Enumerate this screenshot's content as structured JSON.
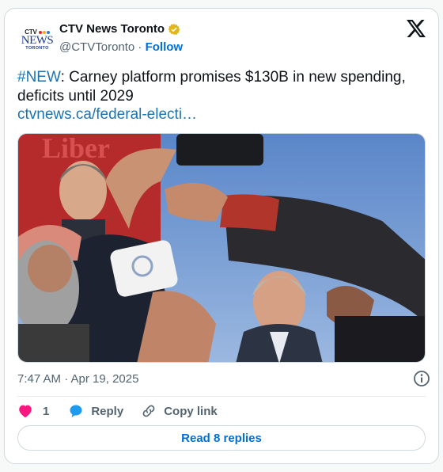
{
  "account": {
    "display_name": "CTV News Toronto",
    "handle": "@CTVToronto",
    "separator": " · ",
    "follow_label": "Follow",
    "logo_brand": "CTV",
    "logo_text": "NEWS",
    "logo_sub": "TORONTO",
    "verified_badge_color": "#e2b719"
  },
  "tweet": {
    "hashtag": "#NEW",
    "text": ": Carney platform promises $130B in new spending, deficits until 2029",
    "link": "ctvnews.ca/federal-electi…",
    "media_sign_text": "Liber"
  },
  "meta": {
    "timestamp": "7:47 AM · Apr 19, 2025"
  },
  "actions": {
    "like_count": "1",
    "reply_label": "Reply",
    "copy_label": "Copy link",
    "read_replies_label": "Read 8 replies"
  },
  "colors": {
    "accent": "#006fd6",
    "link": "#1d73b0",
    "like": "#f91880",
    "reply": "#1d9bf0"
  }
}
